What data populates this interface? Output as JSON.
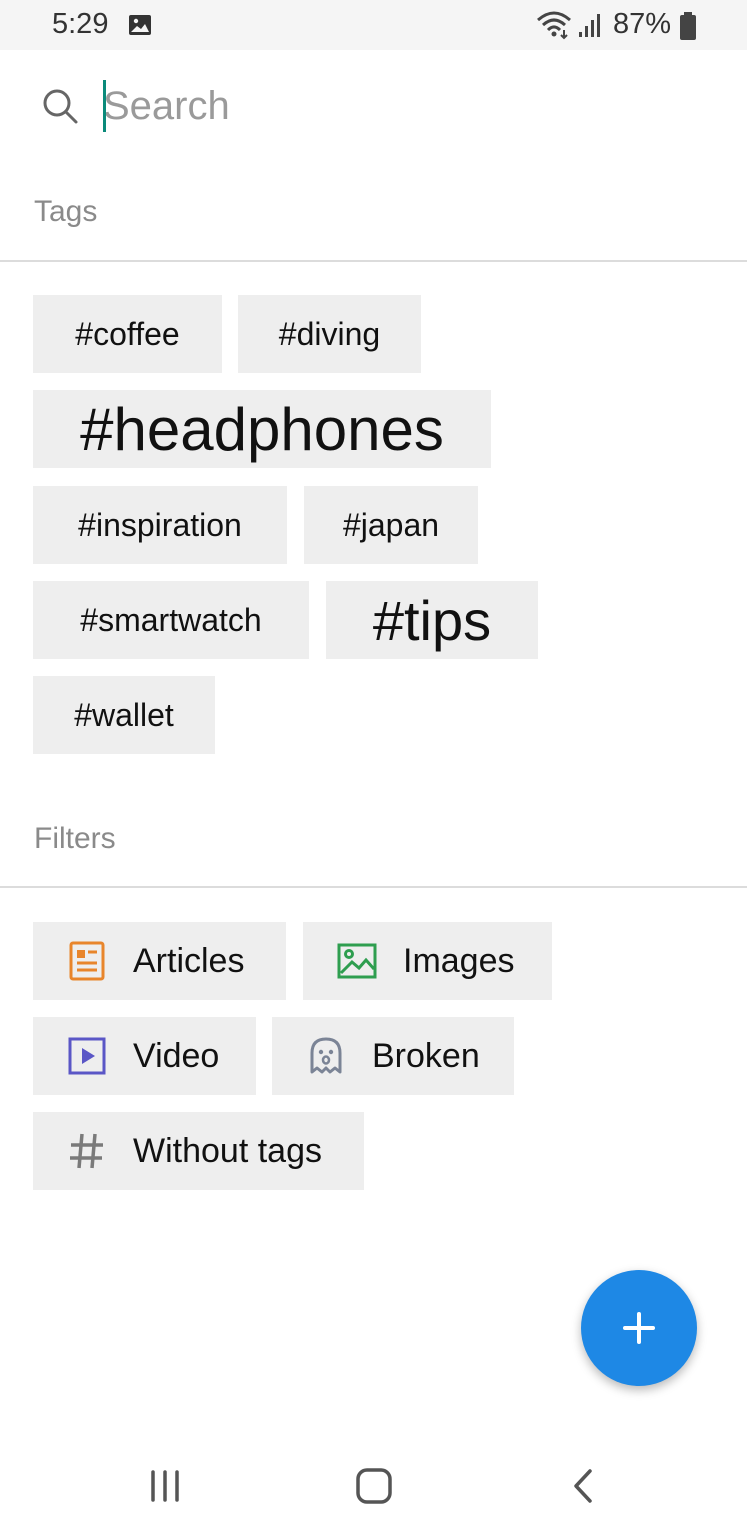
{
  "status_bar": {
    "time": "5:29",
    "battery": "87%"
  },
  "search": {
    "placeholder": "Search"
  },
  "sections": {
    "tags_title": "Tags",
    "filters_title": "Filters"
  },
  "tags": [
    {
      "label": "#coffee"
    },
    {
      "label": "#diving"
    },
    {
      "label": "#headphones"
    },
    {
      "label": "#inspiration"
    },
    {
      "label": "#japan"
    },
    {
      "label": "#smartwatch"
    },
    {
      "label": "#tips"
    },
    {
      "label": "#wallet"
    }
  ],
  "filters": [
    {
      "label": "Articles",
      "icon": "article-icon",
      "color": "#e8852b"
    },
    {
      "label": "Images",
      "icon": "image-icon",
      "color": "#2e9e4f"
    },
    {
      "label": "Video",
      "icon": "video-icon",
      "color": "#5a56c6"
    },
    {
      "label": "Broken",
      "icon": "ghost-icon",
      "color": "#7b8496"
    },
    {
      "label": "Without tags",
      "icon": "hash-icon",
      "color": "#7a7a7a"
    }
  ],
  "fab": {
    "icon": "plus-icon",
    "color": "#1e88e5"
  },
  "nav": {
    "recents_icon": "recents-icon",
    "home_icon": "home-icon",
    "back_icon": "back-icon"
  }
}
